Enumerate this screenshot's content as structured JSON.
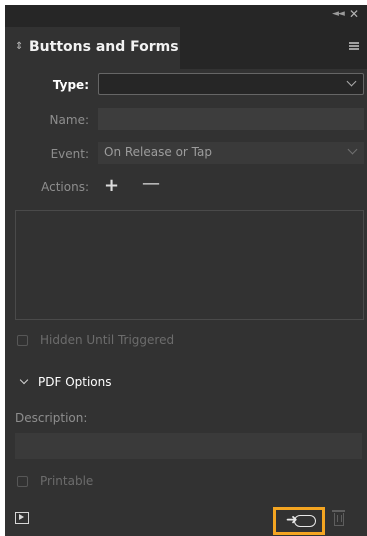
{
  "panel": {
    "tab_icon": "double-arrow-updown-icon",
    "title": "Buttons and Forms",
    "menu_icon": "panel-menu-icon",
    "collapse_icon": "collapse-icon",
    "close_icon": "close-icon"
  },
  "form": {
    "type_label": "Type:",
    "type_value": "",
    "name_label": "Name:",
    "name_value": "",
    "event_label": "Event:",
    "event_value": "On Release or Tap",
    "actions_label": "Actions:",
    "add_action_icon": "plus-icon",
    "remove_action_icon": "minus-icon",
    "actions_list": [],
    "hidden_until_triggered_label": "Hidden Until Triggered",
    "hidden_until_triggered_checked": false
  },
  "pdf_options": {
    "title": "PDF Options",
    "description_label": "Description:",
    "description_value": "",
    "printable_label": "Printable",
    "printable_checked": false
  },
  "footer": {
    "preview_icon": "preview-spread-icon",
    "convert_icon": "convert-to-button-icon",
    "delete_icon": "trash-icon",
    "highlight_color": "#f4a521"
  },
  "colors": {
    "panel_bg": "#323232",
    "tab_strip_bg": "#262626",
    "field_bg": "#3a3a3a",
    "highlight": "#f4a521"
  }
}
